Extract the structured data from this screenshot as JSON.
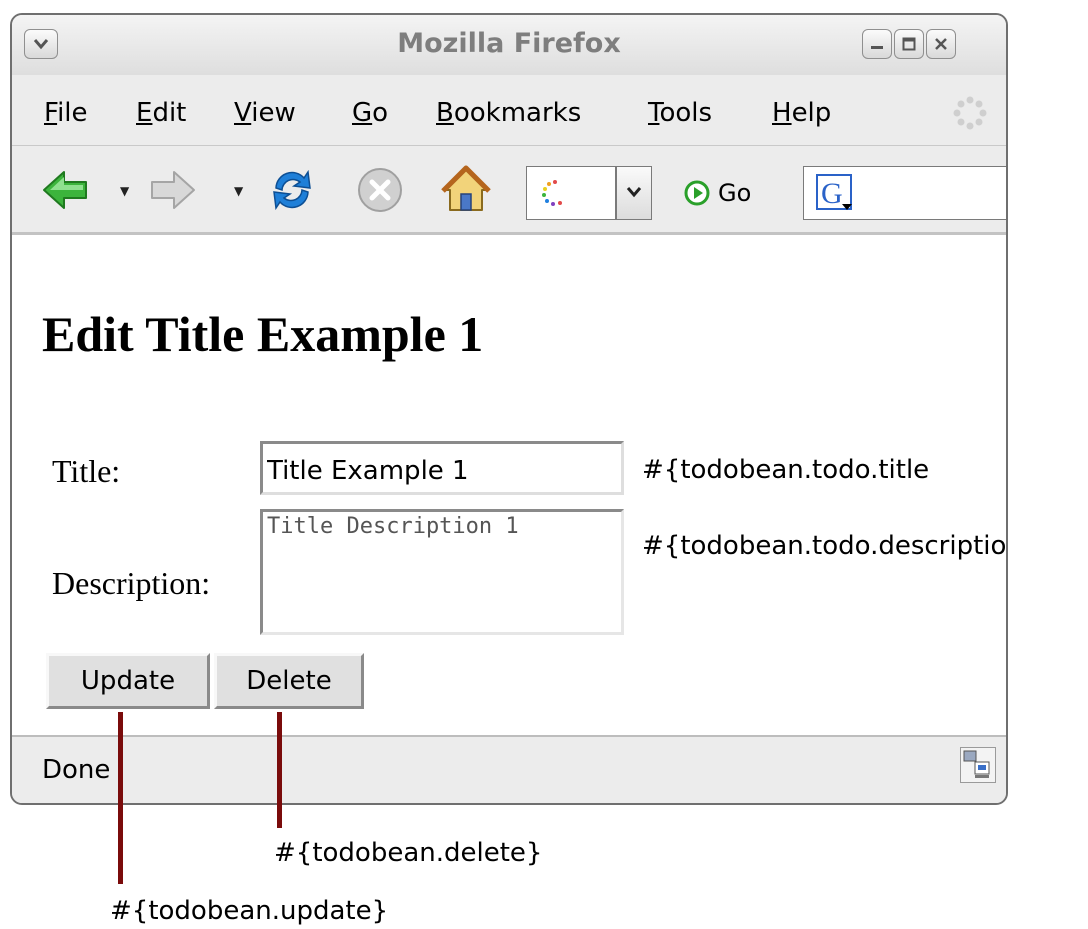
{
  "window": {
    "title": "Mozilla Firefox"
  },
  "menubar": {
    "items": [
      {
        "mnemonic": "F",
        "rest": "ile"
      },
      {
        "mnemonic": "E",
        "rest": "dit"
      },
      {
        "mnemonic": "V",
        "rest": "iew"
      },
      {
        "mnemonic": "G",
        "rest": "o"
      },
      {
        "mnemonic": "B",
        "rest": "ookmarks"
      },
      {
        "mnemonic": "T",
        "rest": "ools"
      },
      {
        "mnemonic": "H",
        "rest": "elp"
      }
    ]
  },
  "toolbar": {
    "go_label": "Go",
    "icons": [
      "back-arrow-icon",
      "forward-arrow-icon",
      "reload-icon",
      "stop-icon",
      "home-icon",
      "google-icon"
    ]
  },
  "page": {
    "heading": "Edit Title Example 1",
    "title_label": "Title:",
    "title_value": "Title Example 1",
    "title_binding_note": "#{todobean.todo.title",
    "description_label": "Description:",
    "description_value": "Title Description 1",
    "description_binding_note": "#{todobean.todo.description}",
    "update_label": "Update",
    "delete_label": "Delete"
  },
  "status": {
    "text": "Done"
  },
  "annotations": {
    "delete_binding": "#{todobean.delete}",
    "update_binding": "#{todobean.update}"
  },
  "colors": {
    "annotation_line": "#7a0b0b",
    "back_arrow": "#3cb43c",
    "reload": "#1e7fd8"
  }
}
